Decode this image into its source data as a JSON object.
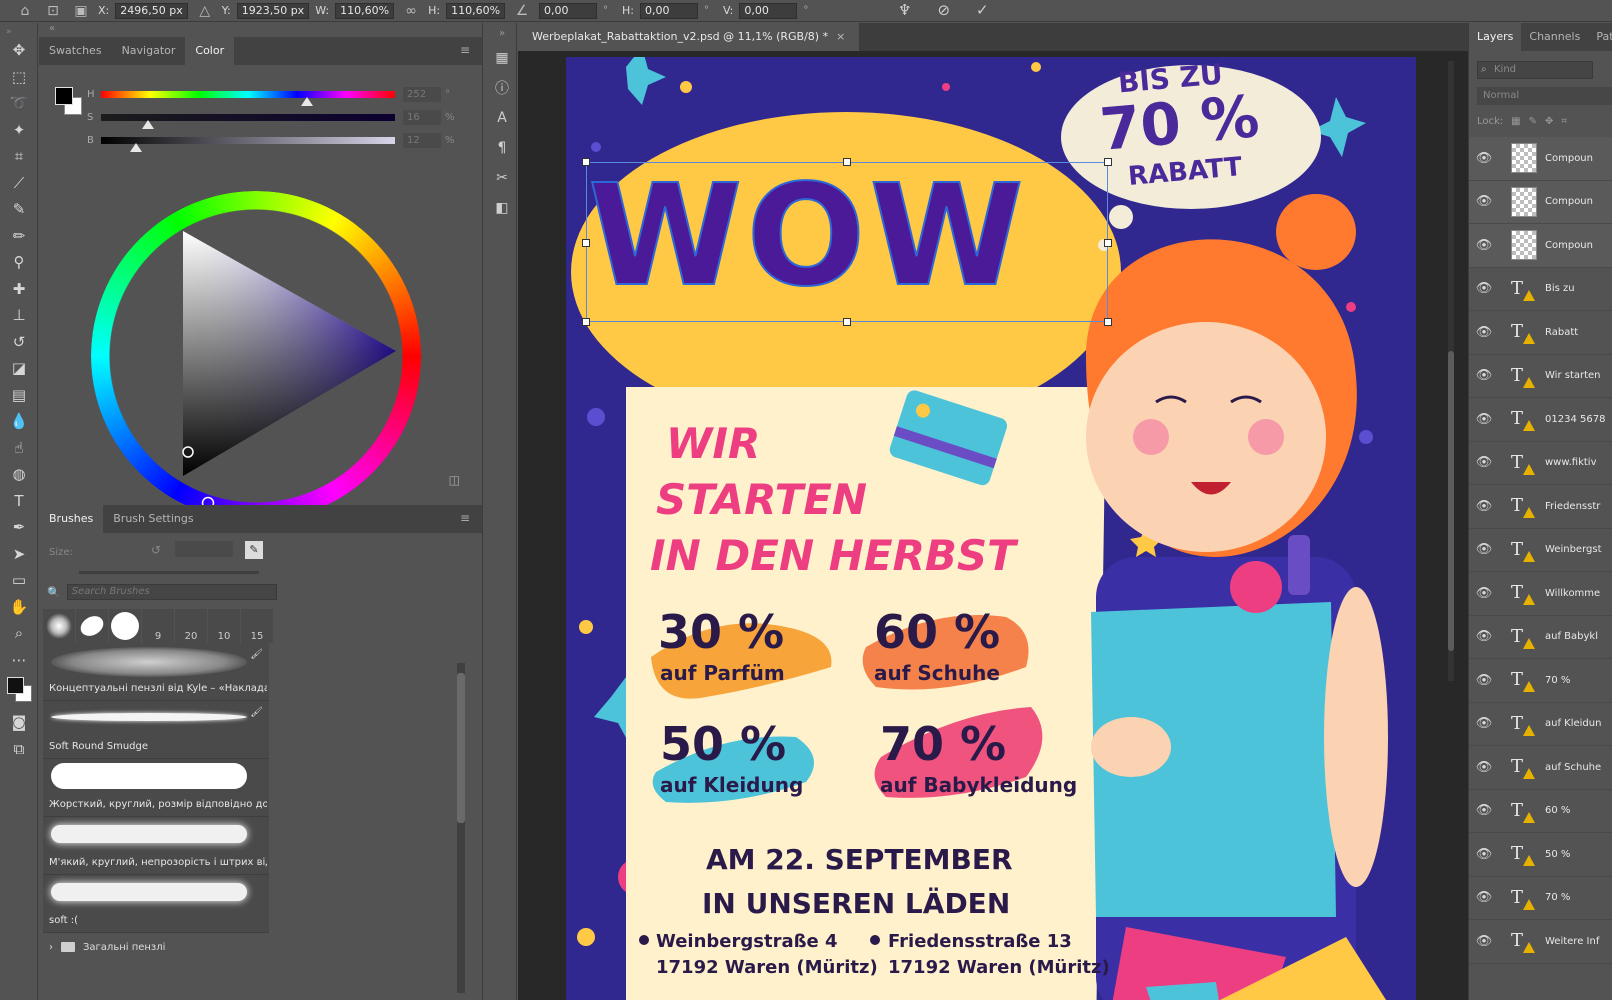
{
  "options_bar": {
    "x_label": "X:",
    "x_value": "2496,50 px",
    "y_label": "Y:",
    "y_value": "1923,50 px",
    "w_label": "W:",
    "w_value": "110,60%",
    "h_label": "H:",
    "h_value": "110,60%",
    "angle_value": "0,00",
    "angle_unit": "°",
    "hskew_label": "H:",
    "hskew_value": "0,00",
    "hskew_unit": "°",
    "vskew_label": "V:",
    "vskew_value": "0,00",
    "vskew_unit": "°"
  },
  "color_panel": {
    "tabs": [
      "Swatches",
      "Navigator",
      "Color"
    ],
    "active_tab": "Color",
    "sliders": [
      {
        "label": "H",
        "value": "252",
        "unit": "°",
        "level": 0.7
      },
      {
        "label": "S",
        "value": "16",
        "unit": "%",
        "level": 0.16
      },
      {
        "label": "B",
        "value": "12",
        "unit": "%",
        "level": 0.12
      }
    ]
  },
  "brushes_panel": {
    "tabs": [
      "Brushes",
      "Brush Settings"
    ],
    "active_tab": "Brushes",
    "size_label": "Size:",
    "search_placeholder": "Search Brushes",
    "presets": [
      "",
      "",
      "",
      "9",
      "20",
      "10",
      "15"
    ],
    "brushes": [
      "Концептуальні пензлі від Kyle – «Накладання ...",
      "Soft Round Smudge",
      "Жорсткий, круглий, розмір відповідно до тиску",
      "М'який, круглий, непрозорість і штрих відпові...",
      "soft :("
    ],
    "folder": "Загальні пензлі"
  },
  "document": {
    "tab_title": "Werbeplakat_Rabattaktion_v2.psd @ 11,1% (RGB/8) *"
  },
  "poster": {
    "badge_line1": "BIS ZU",
    "badge_line2": "70 %",
    "badge_line3": "RABATT",
    "headline": "WOW",
    "sub1": "WIR",
    "sub2": "STARTEN",
    "sub3": "IN DEN HERBST",
    "offers": [
      {
        "pct": "30 %",
        "label": "auf Parfüm",
        "color": "#f7a43a"
      },
      {
        "pct": "60 %",
        "label": "auf Schuhe",
        "color": "#f4824a"
      },
      {
        "pct": "50 %",
        "label": "auf Kleidung",
        "color": "#4cc3d9"
      },
      {
        "pct": "70 %",
        "label": "auf Babykleidung",
        "color": "#f0547e"
      }
    ],
    "date_line1": "AM 22. SEPTEMBER",
    "date_line2": "IN UNSEREN LÄDEN",
    "addr1_street": "Weinbergstraße 4",
    "addr1_city": "17192 Waren (Müritz)",
    "addr2_street": "Friedensstraße 13",
    "addr2_city": "17192 Waren (Müritz)",
    "colors": {
      "background": "#30288f",
      "yellow": "#ffc845",
      "pink": "#ee3e82",
      "paper": "#fff1cc",
      "ink": "#2a1a4a"
    }
  },
  "layers_panel": {
    "tabs": [
      "Layers",
      "Channels",
      "Paths"
    ],
    "active_tab": "Layers",
    "kind_placeholder": "Kind",
    "blend_mode": "Normal",
    "lock_label": "Lock:",
    "layers": [
      {
        "name": "Compoun",
        "type": "composite"
      },
      {
        "name": "Compoun",
        "type": "composite"
      },
      {
        "name": "Compoun",
        "type": "composite"
      },
      {
        "name": "Bis zu",
        "type": "text"
      },
      {
        "name": "Rabatt",
        "type": "text"
      },
      {
        "name": "Wir starten",
        "type": "text"
      },
      {
        "name": "01234 5678",
        "type": "text"
      },
      {
        "name": "www.fiktiv",
        "type": "text"
      },
      {
        "name": "Friedensstr",
        "type": "text"
      },
      {
        "name": "Weinbergst",
        "type": "text"
      },
      {
        "name": "Willkomme",
        "type": "text"
      },
      {
        "name": "auf Babykl",
        "type": "text"
      },
      {
        "name": "70 %",
        "type": "text"
      },
      {
        "name": "auf Kleidun",
        "type": "text"
      },
      {
        "name": "auf Schuhe",
        "type": "text"
      },
      {
        "name": "60 %",
        "type": "text"
      },
      {
        "name": "50 %",
        "type": "text"
      },
      {
        "name": "70 %",
        "type": "text"
      },
      {
        "name": "Weitere Inf",
        "type": "text"
      }
    ]
  }
}
